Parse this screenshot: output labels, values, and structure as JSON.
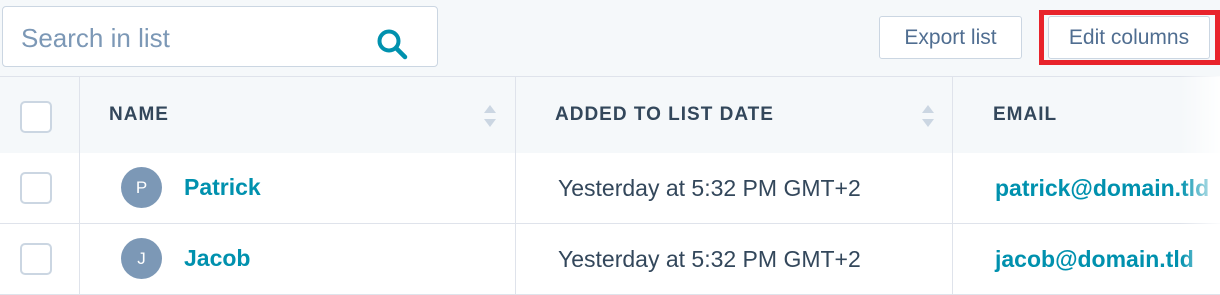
{
  "search": {
    "placeholder": "Search in list",
    "value": "",
    "icon": "search-icon"
  },
  "toolbar": {
    "export_label": "Export list",
    "edit_columns_label": "Edit columns",
    "highlight_color": "#e8232b"
  },
  "table": {
    "columns": [
      {
        "label": "NAME",
        "sortable": true
      },
      {
        "label": "ADDED TO LIST DATE",
        "sortable": true
      },
      {
        "label": "EMAIL",
        "sortable": false
      }
    ],
    "rows": [
      {
        "initial": "P",
        "name": "Patrick",
        "added": "Yesterday at 5:32 PM GMT+2",
        "email": "patrick@domain.tld"
      },
      {
        "initial": "J",
        "name": "Jacob",
        "added": "Yesterday at 5:32 PM GMT+2",
        "email": "jacob@domain.tld"
      }
    ]
  },
  "colors": {
    "link": "#0091ae",
    "avatar": "#7c98b6",
    "text": "#33475b"
  }
}
